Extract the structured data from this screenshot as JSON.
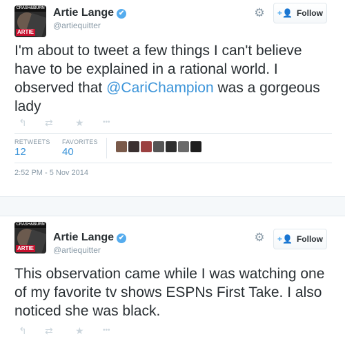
{
  "tweets": [
    {
      "avatar": {
        "top_text": "CRASH&BURN",
        "bottom_text": "ARTIE"
      },
      "name": "Artie Lange",
      "handle": "@artiequitter",
      "follow_label": "Follow",
      "text_before": "I'm about to tweet a few things I can't believe have to be explained in a rational world. I observed that ",
      "mention": "@CariChampion",
      "text_after": " was a gorgeous lady",
      "retweets_label": "RETWEETS",
      "retweets": "12",
      "favorites_label": "FAVORITES",
      "favorites": "40",
      "timestamp": "2:52 PM - 5 Nov 2014"
    },
    {
      "avatar": {
        "top_text": "CRASH&BURN",
        "bottom_text": "ARTIE"
      },
      "name": "Artie Lange",
      "handle": "@artiequitter",
      "follow_label": "Follow",
      "text": "This observation came while I was watching one of my favorite tv shows ESPNs First Take. I also noticed she was black."
    }
  ],
  "icons": {
    "verified": "✔",
    "gear": "⚙",
    "follow": "+👤",
    "reply": "↰",
    "retweet": "⇄",
    "favorite": "★",
    "more": "•••"
  },
  "colors": {
    "link": "#3b94d9",
    "verified": "#55acee",
    "muted": "#8899a6"
  }
}
